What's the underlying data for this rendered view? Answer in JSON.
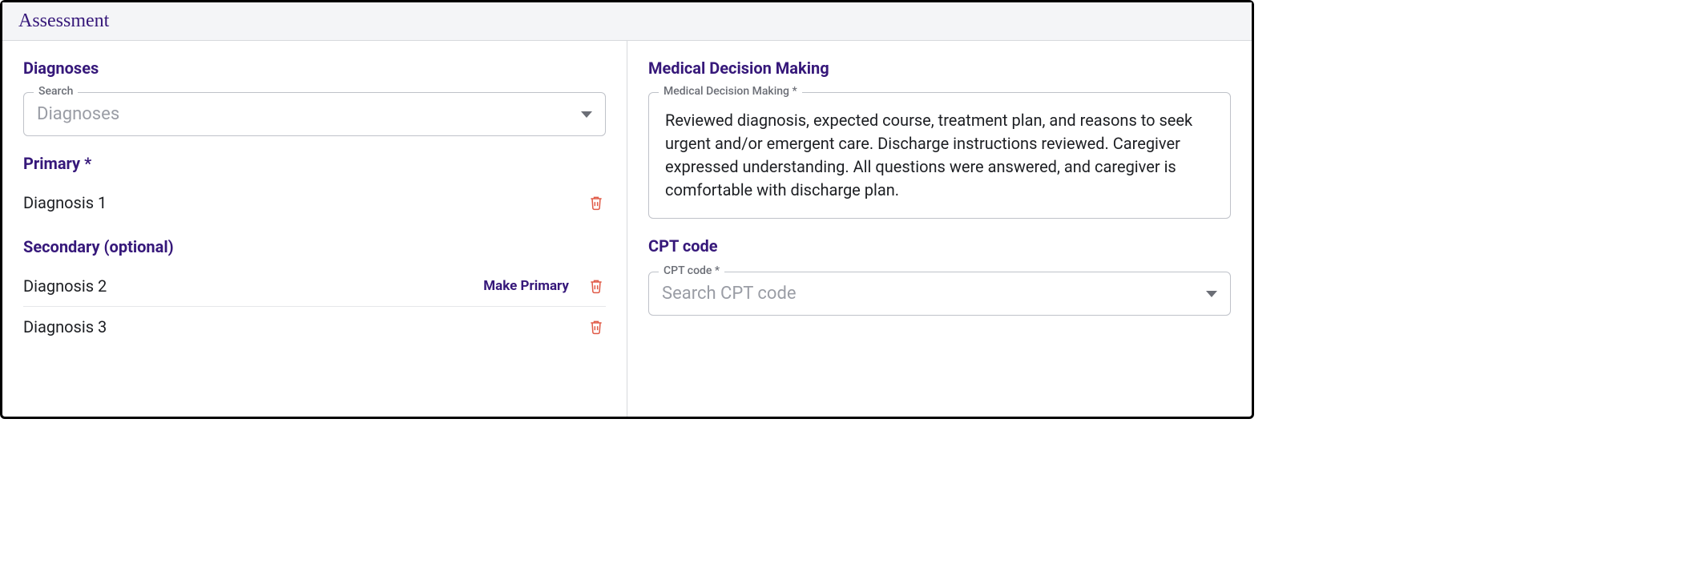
{
  "header": {
    "title": "Assessment"
  },
  "left": {
    "diagnoses_heading": "Diagnoses",
    "search": {
      "legend": "Search",
      "placeholder": "Diagnoses"
    },
    "primary_heading": "Primary *",
    "primary": [
      {
        "label": "Diagnosis 1"
      }
    ],
    "secondary_heading": "Secondary (optional)",
    "secondary": [
      {
        "label": "Diagnosis 2",
        "make_primary": "Make Primary"
      },
      {
        "label": "Diagnosis 3"
      }
    ]
  },
  "right": {
    "mdm_heading": "Medical Decision Making",
    "mdm_field": {
      "legend": "Medical Decision Making *",
      "text": "Reviewed diagnosis, expected course, treatment plan, and reasons to seek urgent and/or emergent care.  Discharge instructions reviewed.  Caregiver expressed understanding.  All questions were answered, and caregiver is comfortable with discharge plan."
    },
    "cpt_heading": "CPT code",
    "cpt_field": {
      "legend": "CPT code *",
      "placeholder": "Search CPT code"
    }
  }
}
